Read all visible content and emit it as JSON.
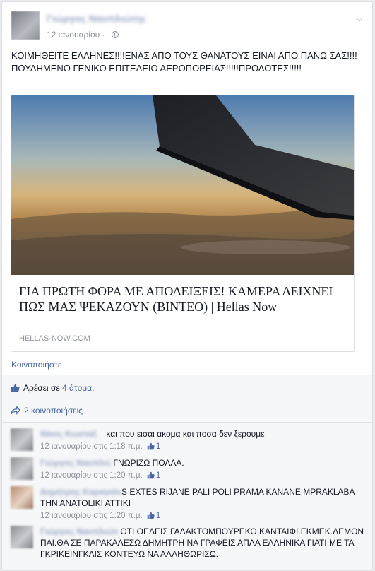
{
  "post": {
    "author": "Γιώργος Ναυπλιώτης",
    "date": "12 ιανουαρίου",
    "text": "ΚΟΙΜΗΘΕΙΤΕ ΕΛΛΗΝΕΣ!!!!ΕΝΑΣ ΑΠΟ ΤΟΥΣ ΘΑΝΑΤΟΥΣ ΕΙΝΑΙ ΑΠΟ ΠΑΝΩ ΣΑΣ!!!!ΠΟΥΛΗΜΕΝΟ ΓΕΝΙΚΟ ΕΠΙΤΕΛΕΙΟ ΑΕΡΟΠΟΡΕΙΑΣ!!!!!ΠΡΟΔΟΤΕΣ!!!!!"
  },
  "link": {
    "title": "ΓΙΑ ΠΡΩΤΗ ΦΟΡΑ ΜΕ ΑΠΟΔΕΙΞΕΙΣ! ΚΑΜΕΡΑ ΔΕΙΧΝΕΙ ΠΩΣ ΜΑΣ ΨΕΚΑΖΟΥΝ (ΒΙΝΤΕΟ) | Hellas Now",
    "domain": "HELLAS-NOW.COM"
  },
  "actions": {
    "share_label": "Κοινοποιήστε"
  },
  "likes": {
    "prefix": "Αρέσει σε",
    "count_text": "4 άτομα",
    "suffix": "."
  },
  "shares": {
    "label": "2 κοινοποιήσεις"
  },
  "comments": [
    {
      "name": "Νίκος Κωσταξ",
      "text": "και που εισαι ακομα και ποσα δεν ξερουμε",
      "time": "12 ιανουαρίου στις 1:18 π.μ.",
      "likes": "1"
    },
    {
      "name": "Γιώργος Ναυπλιώτης",
      "text": "ΓΝΩΡΙΖΩ ΠΟΛΛΑ.",
      "time": "12 ιανουαρίου στις 1:20 π.μ.",
      "likes": "1"
    },
    {
      "name": "Δημήτρης Καραγιάννης",
      "text": "S EXTES RIJANE PALI POLI PRAMA KANANE MPRAKLABA THN ANATOLIKI ATTIKI",
      "time": "12 ιανουαρίου στις 1:20 π.μ.",
      "likes": "1"
    },
    {
      "name": "Γιώργος Ναυπλιώτης",
      "text": "ΟΤΙ ΘΕΛΕΙΣ.ΓΑΛΑΚΤΟΜΠΟΥΡΕΚΟ.ΚΑΝΤΑΙΦΙ.ΕΚΜΕΚ.ΛΕΜΟΝ ΠΑΙ.ΘΑ ΣΕ ΠΑΡΑΚΑΛΕΣΩ ΔΗΜΗΤΡΗ ΝΑ ΓΡΑΦΕΙΣ ΑΠΛΑ ΕΛΛΗΝΙΚΑ ΓΙΑΤΙ ΜΕ ΤΑ ΓΚΡΙΚΕΙΝΓΚΛΙΣ ΚΟΝΤΕΥΩ ΝΑ ΑΛΛΗΘΩΡΙΣΩ.",
      "time": "",
      "likes": ""
    }
  ],
  "colors": {
    "link_blue": "#4b67a1",
    "meta_gray": "#90949c",
    "bar_bg": "#f6f7f9"
  },
  "icons": {
    "audience": "globe-icon",
    "menu": "chevron-down-icon",
    "like": "thumbs-up-icon",
    "share": "share-arrow-icon"
  }
}
